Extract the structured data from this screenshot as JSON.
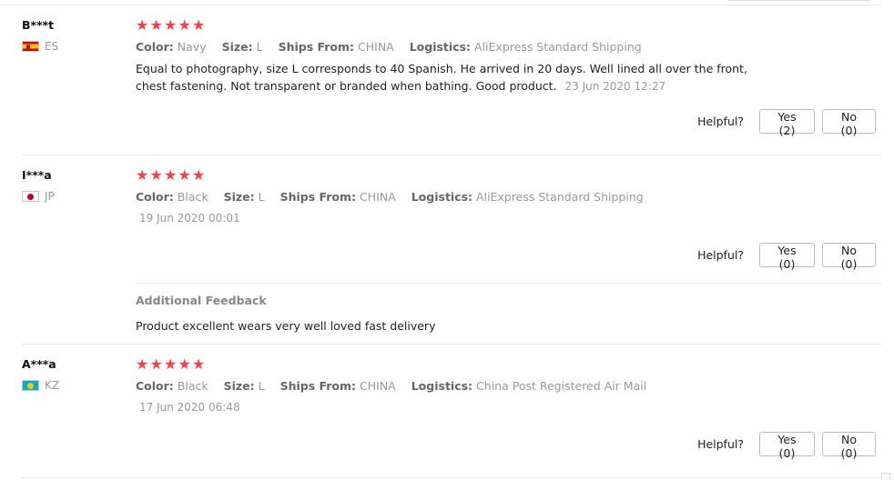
{
  "helpful_label": "Helpful?",
  "star_glyph": "★",
  "accent_star_color": "#f6414a",
  "labels": {
    "color": "Color:",
    "size": "Size:",
    "ships_from": "Ships From:",
    "logistics": "Logistics:"
  },
  "reviews": [
    {
      "user": "B***t",
      "country": "ES",
      "rating": 5,
      "color": "Navy",
      "size": "L",
      "ships_from": "CHINA",
      "logistics": "AliExpress Standard Shipping",
      "text": "Equal to photography, size L corresponds to 40 Spanish. He arrived in 20 days. Well lined all over the front, chest fastening. Not transparent or branded when bathing. Good product.",
      "date": "23 Jun 2020 12:27",
      "yes_label": "Yes (2)",
      "no_label": "No (0)"
    },
    {
      "user": "I***a",
      "country": "JP",
      "rating": 5,
      "color": "Black",
      "size": "L",
      "ships_from": "CHINA",
      "logistics": "AliExpress Standard Shipping",
      "date": "19 Jun 2020 00:01",
      "yes_label": "Yes (0)",
      "no_label": "No (0)",
      "additional_feedback_title": "Additional Feedback",
      "additional_feedback_text": "Product excellent wears very well loved fast delivery"
    },
    {
      "user": "A***a",
      "country": "KZ",
      "rating": 5,
      "color": "Black",
      "size": "L",
      "ships_from": "CHINA",
      "logistics": "China Post Registered Air Mail",
      "date": "17 Jun 2020 06:48",
      "yes_label": "Yes (0)",
      "no_label": "No (0)"
    }
  ]
}
